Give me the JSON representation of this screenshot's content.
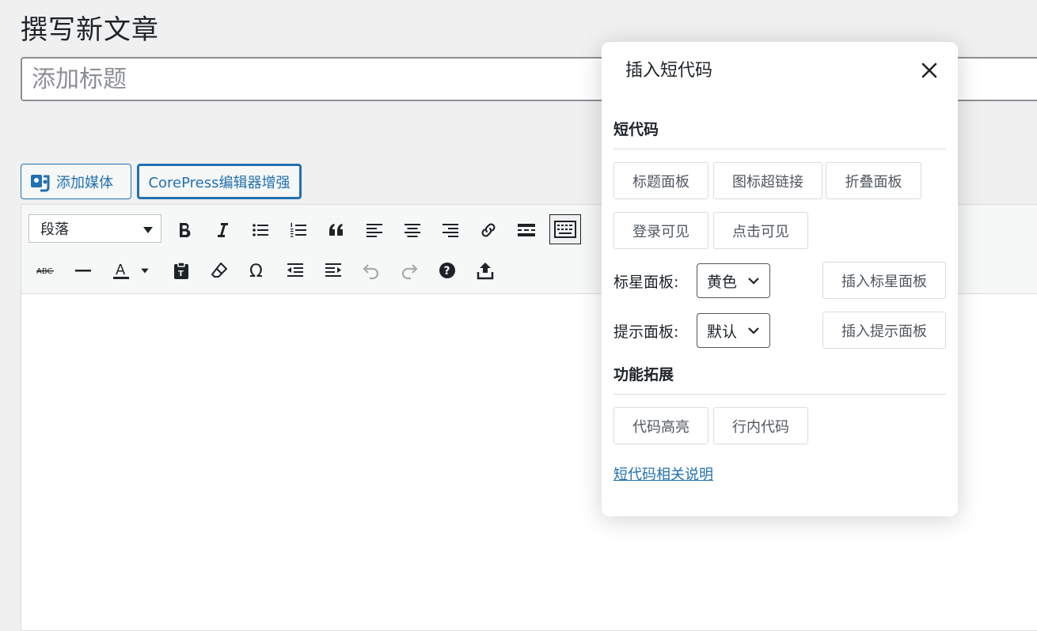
{
  "page": {
    "title": "撰写新文章",
    "title_placeholder": "添加标题"
  },
  "buttons": {
    "add_media": "添加媒体",
    "corepress": "CorePress编辑器增强"
  },
  "toolbar": {
    "format_value": "段落",
    "row1_icons": [
      "bold-icon",
      "italic-icon",
      "bullet-list-icon",
      "numbered-list-icon",
      "blockquote-icon",
      "align-left-icon",
      "align-center-icon",
      "align-right-icon",
      "link-icon",
      "read-more-icon",
      "toolbar-toggle-icon"
    ],
    "row2_icons": [
      "strikethrough-icon",
      "horizontal-line-icon",
      "text-color-icon",
      "paste-text-icon",
      "clear-format-icon",
      "special-char-icon",
      "outdent-icon",
      "indent-icon",
      "undo-icon",
      "redo-icon",
      "help-icon",
      "upload-icon"
    ]
  },
  "dialog": {
    "title": "插入短代码",
    "shortcode_heading": "短代码",
    "shortcode_buttons": [
      "标题面板",
      "图标超链接",
      "折叠面板",
      "登录可见",
      "点击可见"
    ],
    "star_panel_label": "标星面板:",
    "star_panel_value": "黄色",
    "insert_star_panel": "插入标星面板",
    "tip_panel_label": "提示面板:",
    "tip_panel_value": "默认",
    "insert_tip_panel": "插入提示面板",
    "extension_heading": "功能拓展",
    "extension_buttons": [
      "代码高亮",
      "行内代码"
    ],
    "doc_link": "短代码相关说明"
  }
}
